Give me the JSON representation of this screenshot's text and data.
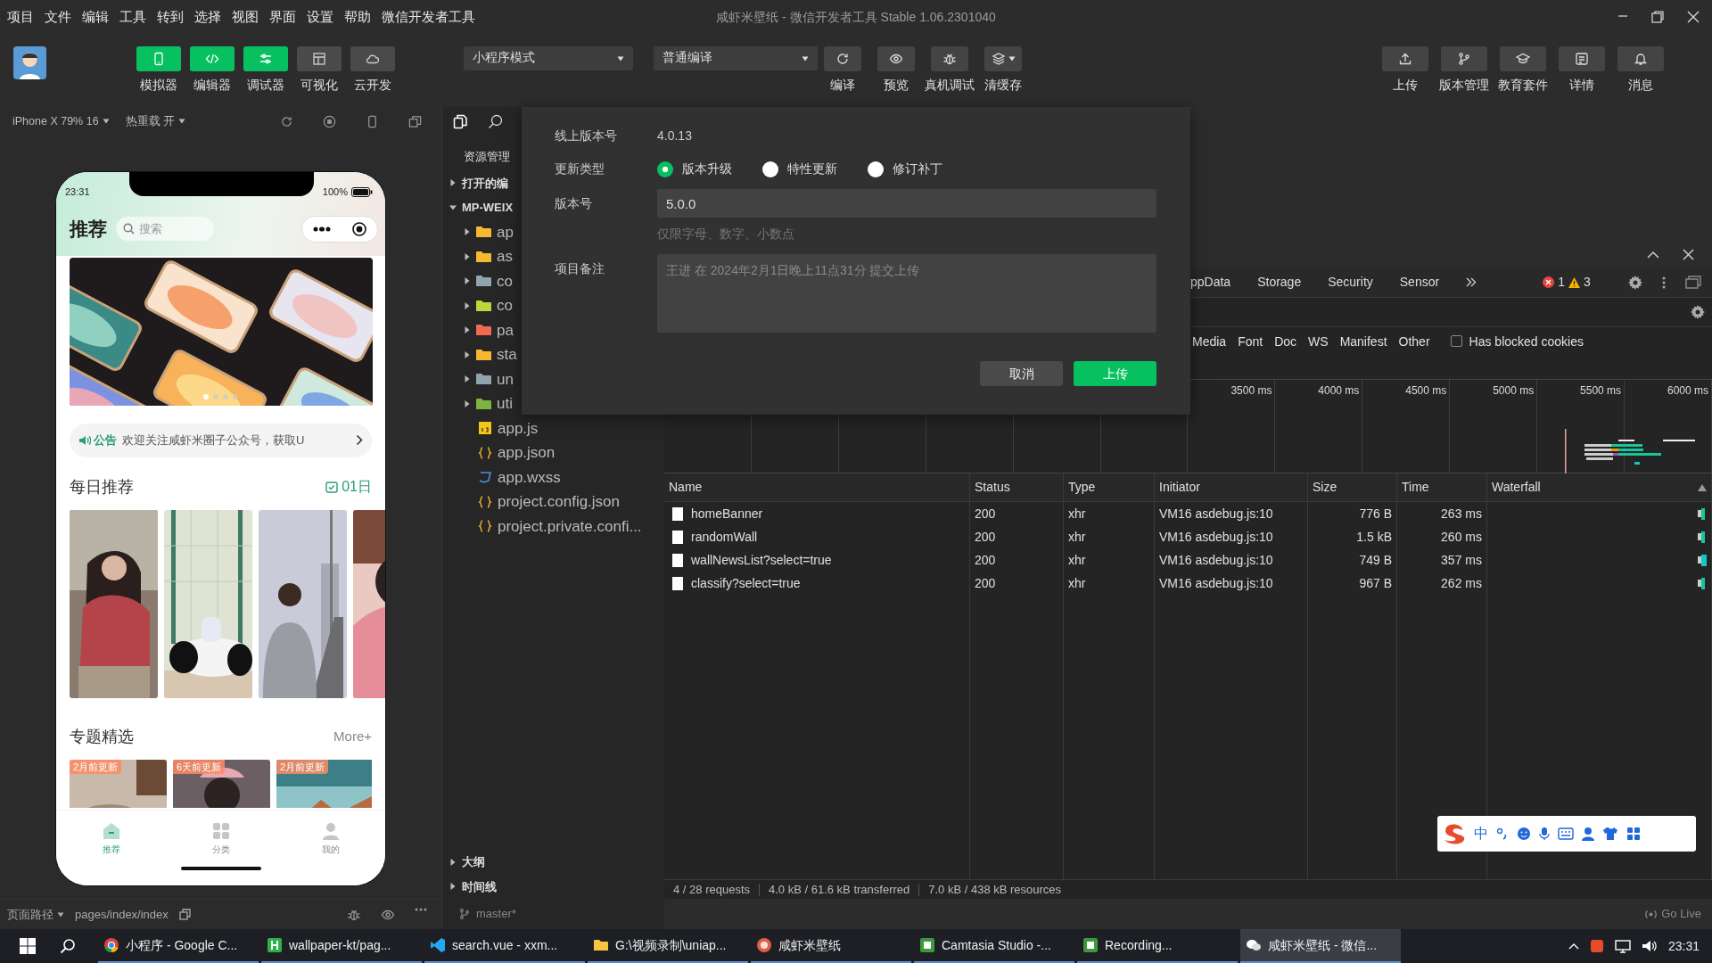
{
  "menu_bar": {
    "items": [
      "项目",
      "文件",
      "编辑",
      "工具",
      "转到",
      "选择",
      "视图",
      "界面",
      "设置",
      "帮助",
      "微信开发者工具"
    ],
    "title": "咸虾米壁纸 - 微信开发者工具 Stable 1.06.2301040"
  },
  "toolbar": {
    "view_buttons": [
      {
        "label": "模拟器",
        "kind": "phone",
        "on": true
      },
      {
        "label": "编辑器",
        "kind": "code",
        "on": true
      },
      {
        "label": "调试器",
        "kind": "sliders",
        "on": true
      },
      {
        "label": "可视化",
        "kind": "layout",
        "on": false
      },
      {
        "label": "云开发",
        "kind": "cloud",
        "on": false
      }
    ],
    "mode_select": "小程序模式",
    "compile_select": "普通编译",
    "actions": [
      {
        "label": "编译",
        "kind": "refresh"
      },
      {
        "label": "预览",
        "kind": "eye"
      },
      {
        "label": "真机调试",
        "kind": "bug"
      },
      {
        "label": "清缓存",
        "kind": "layers"
      }
    ],
    "right_actions": [
      {
        "label": "上传",
        "kind": "upload"
      },
      {
        "label": "版本管理",
        "kind": "branch"
      },
      {
        "label": "教育套件",
        "kind": "cap"
      },
      {
        "label": "详情",
        "kind": "info"
      },
      {
        "label": "消息",
        "kind": "bell"
      }
    ]
  },
  "simulator": {
    "device": "iPhone X 79% 16",
    "hot_reload": "热重载 开",
    "phone": {
      "time": "23:31",
      "battery": "100%",
      "title": "推荐",
      "search_placeholder": "搜索",
      "notice_label": "公告",
      "notice_text": "欢迎关注咸虾米圈子公众号，获取U",
      "daily_title": "每日推荐",
      "daily_date": "01日",
      "topic_title": "专题精选",
      "topic_more": "More+",
      "topics": [
        {
          "tag": "2月前更新"
        },
        {
          "tag": "6天前更新"
        },
        {
          "tag": "2月前更新"
        }
      ],
      "tabs": [
        {
          "label": "推荐",
          "kind": "home",
          "selected": true
        },
        {
          "label": "分类",
          "kind": "grid",
          "selected": false
        },
        {
          "label": "我的",
          "kind": "user",
          "selected": false
        }
      ]
    },
    "page_path_label": "页面路径",
    "page_path": "pages/index/index"
  },
  "explorer": {
    "title": "资源管理",
    "sections": [
      {
        "label": "打开的编",
        "expanded": false
      },
      {
        "label": "MP-WEIX",
        "expanded": true
      }
    ],
    "items": [
      {
        "name": "ap",
        "kind": "folder",
        "color": "#f5b82e"
      },
      {
        "name": "as",
        "kind": "folder",
        "color": "#f5b82e"
      },
      {
        "name": "co",
        "kind": "folder",
        "color": "#90a4ae"
      },
      {
        "name": "co",
        "kind": "folder",
        "color": "#c0d43b"
      },
      {
        "name": "pa",
        "kind": "folder",
        "color": "#ef6a4f"
      },
      {
        "name": "sta",
        "kind": "folder",
        "color": "#f5b82e"
      },
      {
        "name": "un",
        "kind": "folder",
        "color": "#90a4ae"
      },
      {
        "name": "uti",
        "kind": "folder",
        "color": "#7cb342"
      },
      {
        "name": "app.js",
        "kind": "js"
      },
      {
        "name": "app.json",
        "kind": "json"
      },
      {
        "name": "app.wxss",
        "kind": "wxss"
      },
      {
        "name": "project.config.json",
        "kind": "json"
      },
      {
        "name": "project.private.confi...",
        "kind": "json"
      }
    ],
    "outline": "大纲",
    "timeline": "时间线",
    "branch": "master*"
  },
  "dialog": {
    "online_version_label": "线上版本号",
    "online_version": "4.0.13",
    "update_type_label": "更新类型",
    "update_types": [
      {
        "label": "版本升级",
        "selected": true
      },
      {
        "label": "特性更新",
        "selected": false
      },
      {
        "label": "修订补丁",
        "selected": false
      }
    ],
    "version_label": "版本号",
    "version_value": "5.0.0",
    "version_hint": "仅限字母、数字、小数点",
    "note_label": "项目备注",
    "note_placeholder": "王进 在 2024年2月1日晚上11点31分 提交上传",
    "buttons": [
      {
        "label": "取消",
        "kind": "secondary"
      },
      {
        "label": "上传",
        "kind": "primary"
      }
    ]
  },
  "devtools": {
    "tabs": [
      {
        "label": "ppData",
        "selected": false
      },
      {
        "label": "Storage",
        "selected": false
      },
      {
        "label": "Security",
        "selected": false
      },
      {
        "label": "Sensor",
        "selected": false
      }
    ],
    "errors": "1",
    "warnings": "3",
    "type_filters": [
      "Media",
      "Font",
      "Doc",
      "WS",
      "Manifest",
      "Other"
    ],
    "blocked_cookies": {
      "label": "Has blocked cookies",
      "checked": false
    },
    "timeline_ticks": [
      "3500 ms",
      "4000 ms",
      "4500 ms",
      "5000 ms",
      "5500 ms",
      "6000 ms"
    ],
    "table": {
      "columns": [
        "Name",
        "Status",
        "Type",
        "Initiator",
        "Size",
        "Time",
        "Waterfall"
      ],
      "rows": [
        {
          "name": "homeBanner",
          "status": "200",
          "type": "xhr",
          "initiator": "VM16 asdebug.js:10",
          "size": "776 B",
          "time": "263 ms"
        },
        {
          "name": "randomWall",
          "status": "200",
          "type": "xhr",
          "initiator": "VM16 asdebug.js:10",
          "size": "1.5 kB",
          "time": "260 ms"
        },
        {
          "name": "wallNewsList?select=true",
          "status": "200",
          "type": "xhr",
          "initiator": "VM16 asdebug.js:10",
          "size": "749 B",
          "time": "357 ms"
        },
        {
          "name": "classify?select=true",
          "status": "200",
          "type": "xhr",
          "initiator": "VM16 asdebug.js:10",
          "size": "967 B",
          "time": "262 ms"
        }
      ]
    },
    "summary": [
      "4 / 28 requests",
      "4.0 kB / 61.6 kB transferred",
      "7.0 kB / 438 kB resources"
    ],
    "go_live": "Go Live"
  },
  "ime": {
    "mode": "中"
  },
  "taskbar": {
    "items": [
      {
        "label": "小程序 - Google C...",
        "kind": "chrome",
        "selected": false
      },
      {
        "label": "wallpaper-kt/pag...",
        "kind": "hbuilder",
        "selected": false
      },
      {
        "label": "search.vue - xxm...",
        "kind": "vscode",
        "selected": false
      },
      {
        "label": "G:\\视频录制\\uniap...",
        "kind": "folder",
        "selected": false
      },
      {
        "label": "咸虾米壁纸",
        "kind": "app",
        "selected": false
      },
      {
        "label": "Camtasia Studio -...",
        "kind": "camtasia",
        "selected": false
      },
      {
        "label": "Recording...",
        "kind": "camtasia",
        "selected": false
      },
      {
        "label": "咸虾米壁纸 - 微信...",
        "kind": "wechat",
        "selected": true
      }
    ],
    "time": "23:31"
  }
}
